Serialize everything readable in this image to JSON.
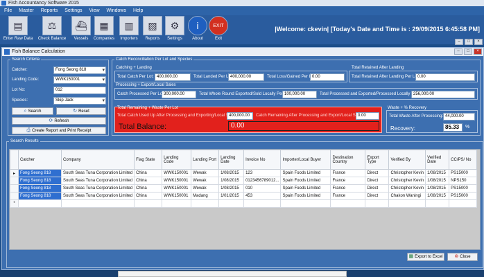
{
  "window": {
    "title": "Fish Accountancy Software 2015"
  },
  "menu": [
    "File",
    "Master",
    "Reports",
    "Settings",
    "View",
    "Windows",
    "Help"
  ],
  "toolbar": [
    {
      "label": "Enter Raw Data",
      "icon": "document-icon"
    },
    {
      "label": "Check Balance",
      "icon": "balance-scale-icon"
    },
    {
      "label": "Vessels",
      "icon": "vessel-icon"
    },
    {
      "label": "Companies",
      "icon": "building-icon"
    },
    {
      "label": "Importers",
      "icon": "importer-icon"
    },
    {
      "label": "Reports",
      "icon": "report-icon"
    },
    {
      "label": "Settings",
      "icon": "settings-icon"
    },
    {
      "label": "About",
      "icon": "info-icon"
    },
    {
      "label": "Exit",
      "icon": "exit-icon"
    }
  ],
  "welcome": "|Welcome:  ckevin|  [Today's Date and Time is : 29/09/2015 6:45:58 PM]",
  "inner_title": "Fish Balance Calculation",
  "search": {
    "legend": "Search Criteria",
    "catcher_label": "Catcher:",
    "catcher_value": "Fong Seong 818",
    "landing_label": "Landing Code:",
    "landing_value": "WWK150001",
    "lot_label": "Lot No:",
    "lot_value": "012",
    "species_label": "Species:",
    "species_value": "Skip Jack",
    "search_btn": "Search",
    "reset_btn": "Reset",
    "refresh_btn": "Refresh",
    "report_btn": "Create Report and Print Receipt"
  },
  "recon": {
    "legend": "Catch Reconciliation Per Lot and Species",
    "catch_landing_title": "Catching + Landing",
    "total_catch_label": "Total Catch Per Lot:",
    "total_catch": "400,000.00",
    "total_landed_label": "Total Landed Per Lot:",
    "total_landed": "400,000.00",
    "loss_label": "Total Loss/Gained Per Lot:",
    "loss": "0.00",
    "retained_title": "Total Retained After Landing",
    "retained_label": "Total Retained After Landing Per Lot:",
    "retained": "0.00",
    "processing_title": "Processing + Export/Local Sales",
    "processed_label": "Catch Processed Per Lot:",
    "processed": "300,000.00",
    "whole_round_label": "Total Whole Round Exported/Sold Locally  Per Lot:",
    "whole_round": "100,000.00",
    "proc_export_label": "Total Processed and Exported/Processed Locally Per Lot:",
    "proc_export": "256,000.00",
    "remaining_title": "Total Remaining + Waste Per Lot",
    "used_label": "Total Catch Used Up After Processing and Exporting/Local Sales:",
    "used": "400,000.00",
    "remaining_label": "Catch Remaining After Processing and Export/Local Sales:",
    "remaining": "0.00",
    "balance_label": "Total Balance:",
    "balance": "0.00",
    "waste_title": "Waste + % Recovery",
    "waste_label": "Total Waste After Processing:",
    "waste": "44,000.00",
    "recovery_label": "Recovery:",
    "recovery": "85.33",
    "recovery_unit": "%"
  },
  "results": {
    "legend": "Search Results",
    "columns": [
      "Catcher",
      "Company",
      "Flag State",
      "Landing Code",
      "Landing Port",
      "Landing Date",
      "Invoice No",
      "Importer/Local Buyer",
      "Destination Country",
      "Export Type",
      "Verified By",
      "Verified Date",
      "CC/PS/ No"
    ],
    "rows": [
      [
        "Fong Seong 818",
        "South Seas Tuna Corporation Limited",
        "China",
        "WWK150001",
        "Wewak",
        "1/08/2015",
        "123",
        "Spain Foods Limited",
        "France",
        "Direct",
        "Christopher Kevin",
        "1/08/2015",
        "PS15000"
      ],
      [
        "Fong Seong 818",
        "South Seas Tuna Corporation Limited",
        "China",
        "WWK150001",
        "Wewak",
        "1/08/2015",
        "0123456789012...",
        "Spain Foods Limited",
        "France",
        "Direct",
        "Christopher Kevin",
        "1/08/2015",
        "NPS150"
      ],
      [
        "Fong Seong 818",
        "South Seas Tuna Corporation Limited",
        "China",
        "WWK150001",
        "Wewak",
        "1/08/2015",
        "010",
        "Spain Foods Limited",
        "France",
        "Direct",
        "Christopher Kevin",
        "1/08/2015",
        "PS15000"
      ],
      [
        "Fong Seong 818",
        "South Seas Tuna Corporation Limited",
        "China",
        "WWK150001",
        "Madang",
        "1/01/2015",
        "453",
        "Spain Foods Limited",
        "France",
        "Direct",
        "Chakon Waningi",
        "1/08/2015",
        "PS15000"
      ]
    ],
    "new_row_marker": "*",
    "current_row_marker": "▸",
    "export_btn": "Export to Excel",
    "close_btn": "Close"
  }
}
